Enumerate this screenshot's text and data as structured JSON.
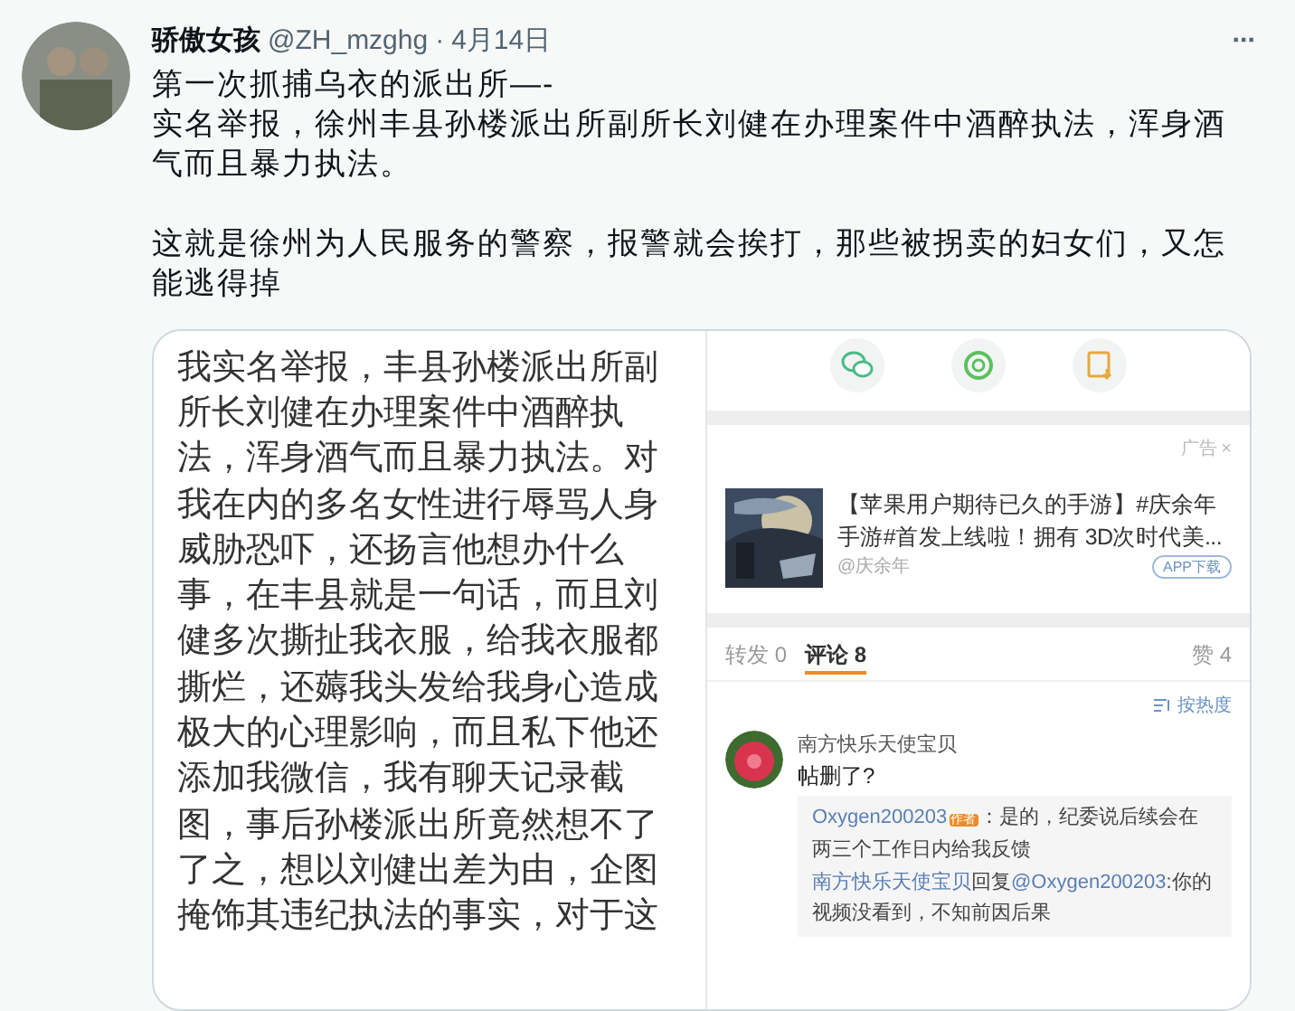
{
  "post": {
    "author": "骄傲女孩",
    "handle": "@ZH_mzghg",
    "separator": "·",
    "date": "4月14日",
    "more": "···",
    "paragraphs": [
      {
        "lines": [
          "第一次抓捕乌衣的派出所—-",
          "实名举报，徐州丰县孙楼派出所副所长刘健在办理案件中酒醉执法，浑身酒气而且暴力执法。"
        ]
      },
      {
        "lines": [
          "这就是徐州为人民服务的警察，报警就会挨打，那些被拐卖的妇女们，又怎能逃得掉"
        ]
      }
    ]
  },
  "attachment": {
    "report_text": "我实名举报，丰县孙楼派出所副所长刘健在办理案件中酒醉执法，浑身酒气而且暴力执法。对我在内的多名女性进行辱骂人身威胁恐吓，还扬言他想办什么事，在丰县就是一句话，而且刘健多次撕扯我衣服，给我衣服都撕烂，还薅我头发给我身心造成极大的心理影响，而且私下他还添加我微信，我有聊天记录截图，事后孙楼派出所竟然想不了了之，想以刘健出差为由，企图掩饰其违纪执法的事实，对于这",
    "share_icons": [
      {
        "kind": "wechat"
      },
      {
        "kind": "moments"
      },
      {
        "kind": "save"
      }
    ],
    "ad": {
      "label": "广告",
      "close": "×",
      "title": "【苹果用户期待已久的手游】#庆余年手游#首发上线啦！拥有 3D次时代美...",
      "source": "@庆余年",
      "button": "APP下载"
    },
    "tabs": [
      {
        "label": "转发 0",
        "selected": false
      },
      {
        "label": "评论 8",
        "selected": true
      },
      {
        "label": "赞 4",
        "selected": false
      }
    ],
    "sort": "按热度",
    "comments": [
      {
        "author": "南方快乐天使宝贝",
        "text": "帖删了?",
        "replies": [
          {
            "user": "Oxygen200203",
            "badge": "作者",
            "text": "：是的，纪委说后续会在两三个工作日内给我反馈"
          },
          {
            "user": "南方快乐天使宝贝",
            "verb": "回复",
            "mention": "@Oxygen200203",
            "text": ":你的视频没看到，不知前因后果"
          }
        ]
      }
    ]
  }
}
